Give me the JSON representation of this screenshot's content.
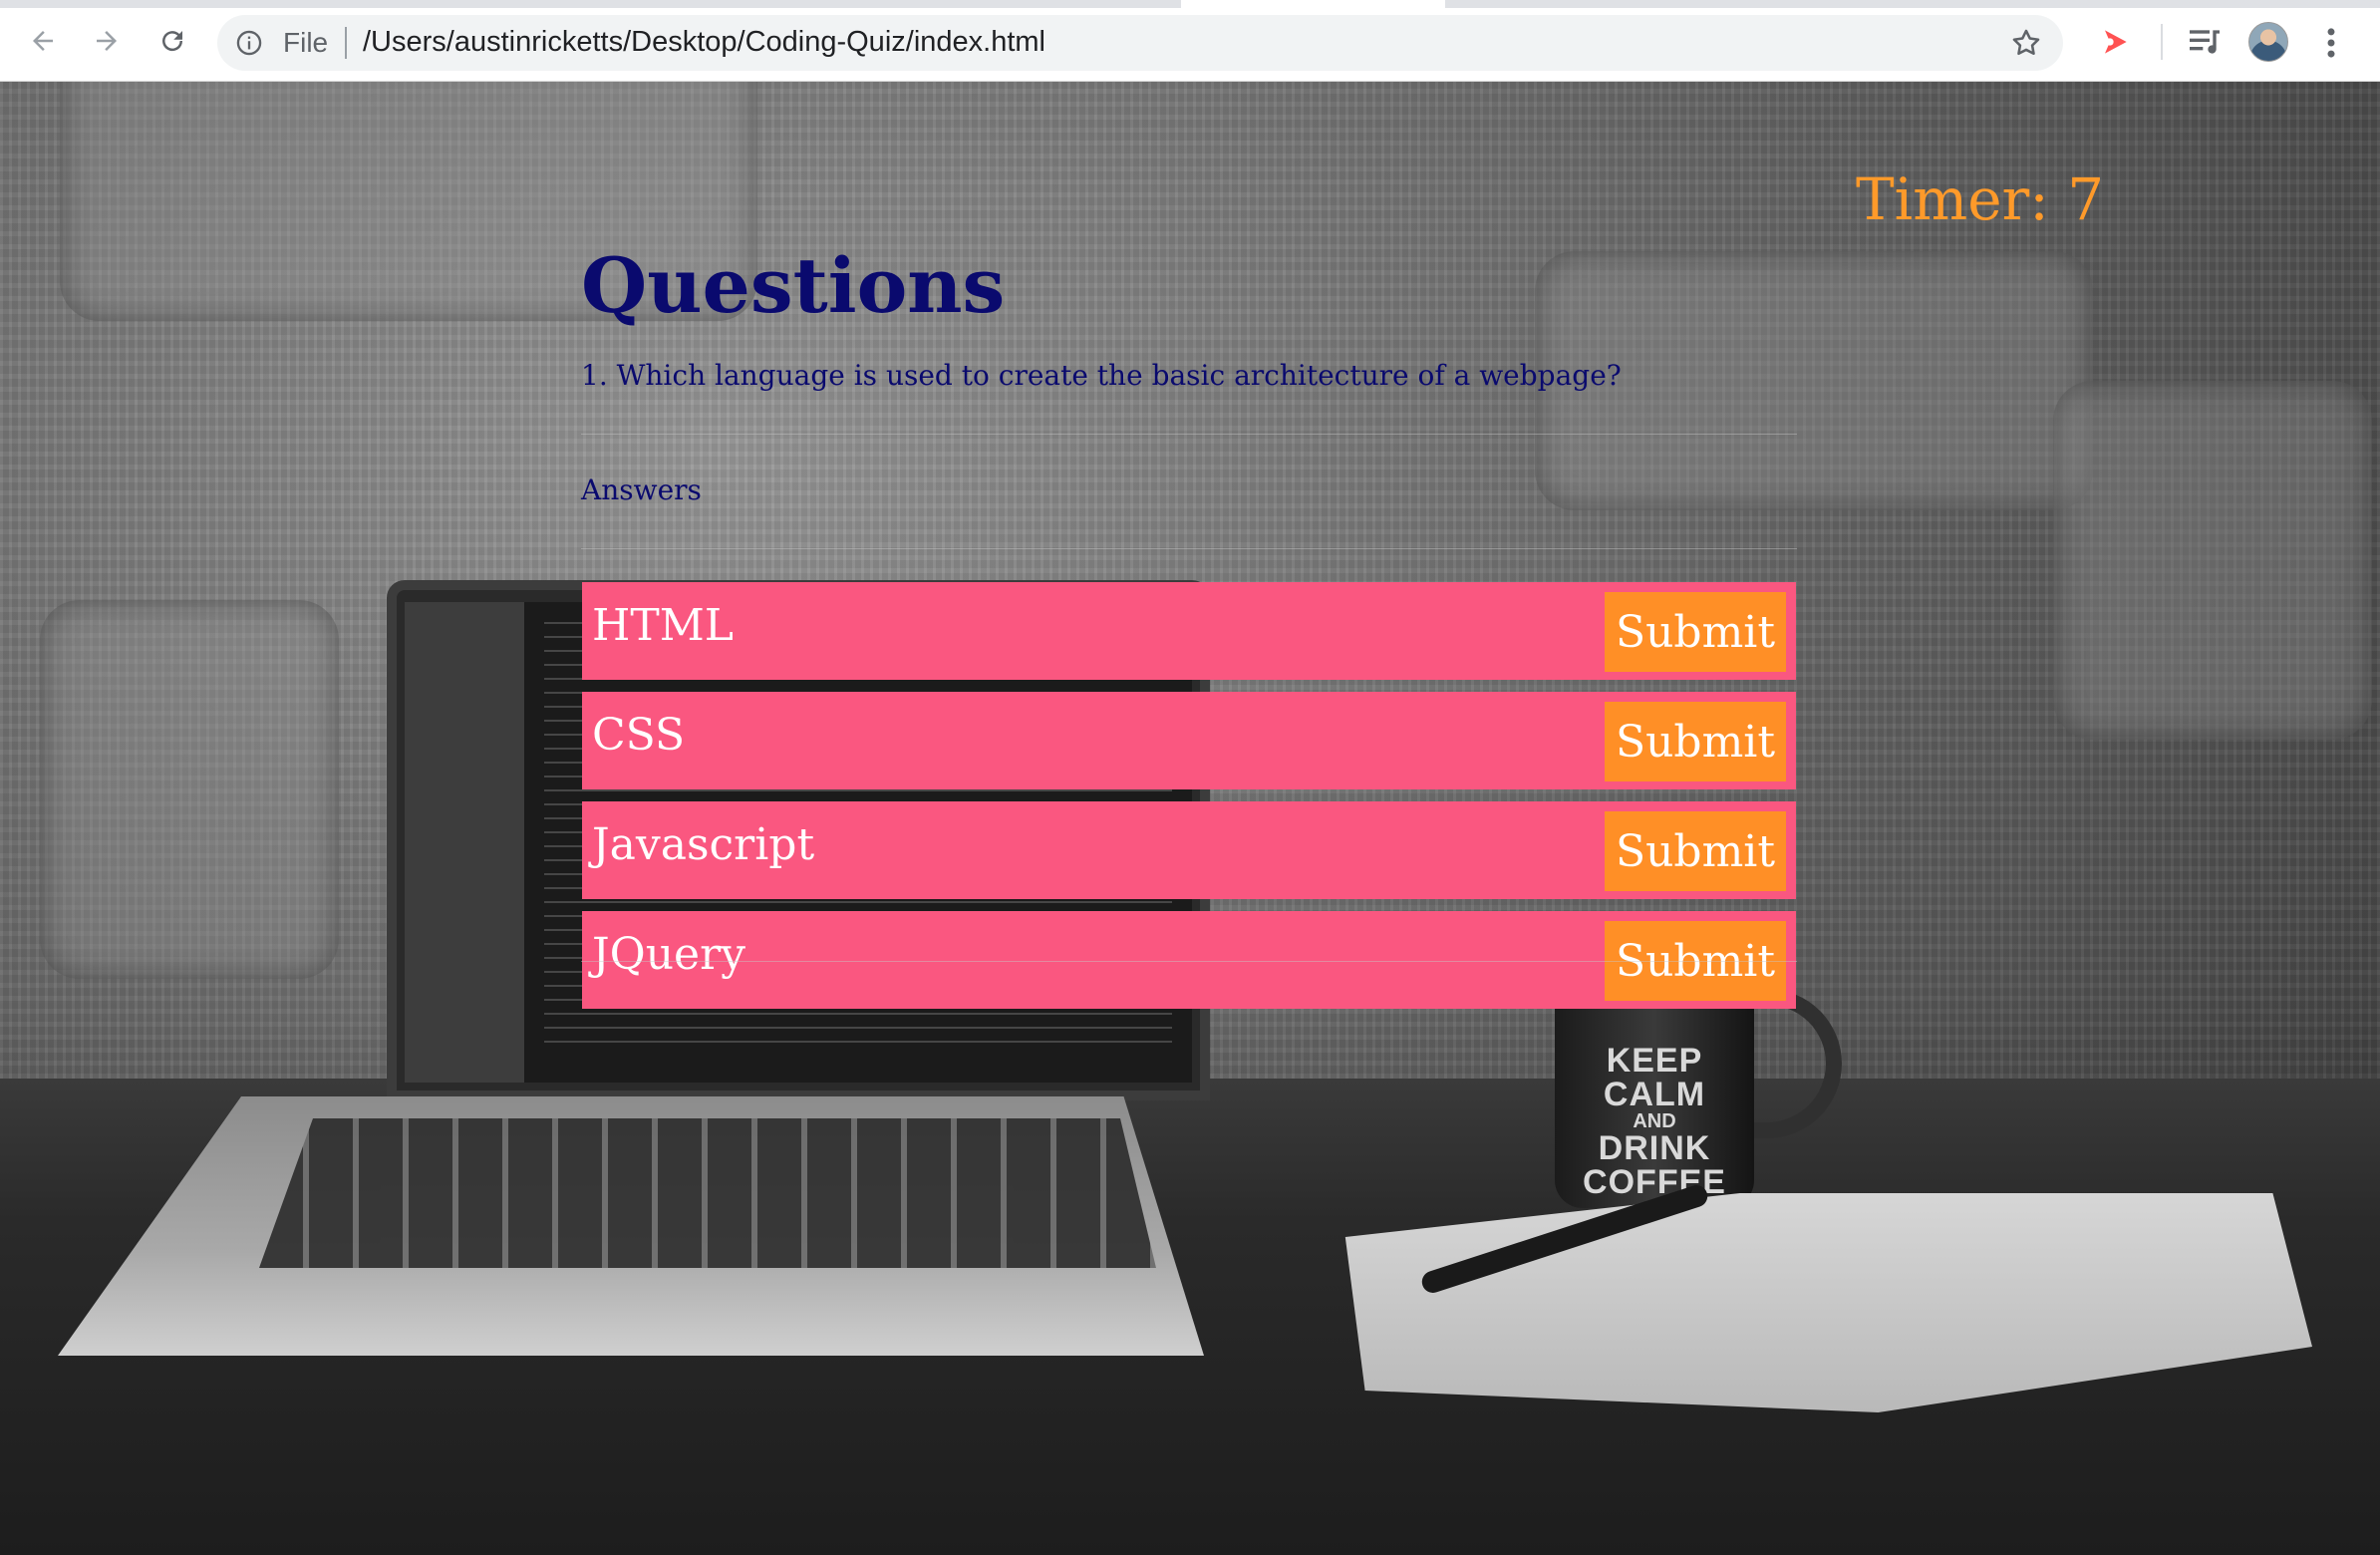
{
  "browser": {
    "omnibox_label": "File",
    "url": "/Users/austinricketts/Desktop/Coding-Quiz/index.html"
  },
  "quiz": {
    "timer_text": "Timer: 7",
    "title": "Questions",
    "question": "1. Which language is used to create the basic architecture of a webpage?",
    "answers_label": "Answers",
    "answers": [
      {
        "text": "HTML",
        "button": "Submit"
      },
      {
        "text": "CSS",
        "button": "Submit"
      },
      {
        "text": "Javascript",
        "button": "Submit"
      },
      {
        "text": "JQuery",
        "button": "Submit"
      }
    ]
  },
  "background": {
    "mug_line1": "KEEP",
    "mug_line2": "CALM",
    "mug_line3": "AND",
    "mug_line4": "DRINK",
    "mug_line5": "COFFEE"
  },
  "colors": {
    "answer_row": "#fa5780",
    "submit_button": "#ff8f26",
    "timer": "#ff9a2a",
    "heading_text": "#0a0a6e"
  }
}
